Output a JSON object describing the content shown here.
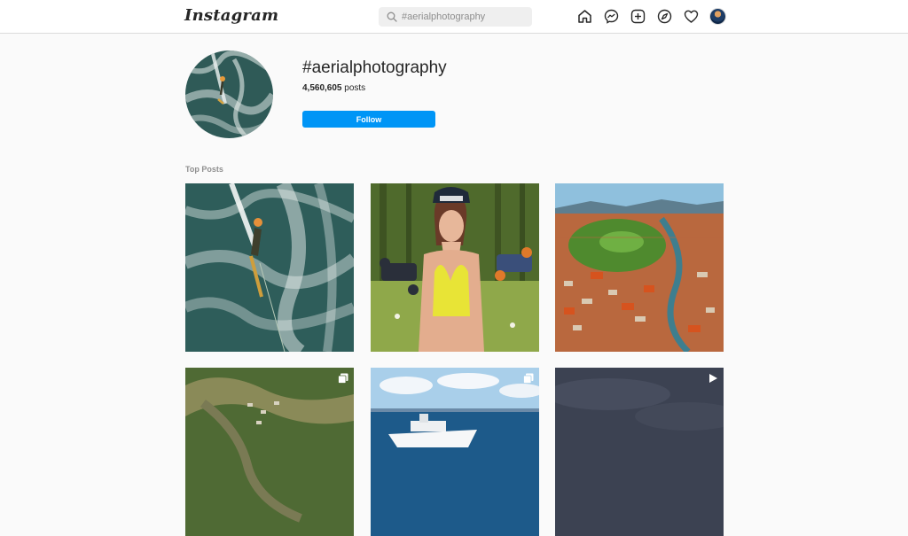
{
  "header": {
    "logo_text": "Instagram",
    "search": {
      "value": "",
      "placeholder": "#aerialphotography"
    },
    "icons": [
      "home-icon",
      "messenger-icon",
      "new-post-icon",
      "explore-icon",
      "activity-heart-icon",
      "profile-avatar"
    ]
  },
  "hashtag": {
    "title": "#aerialphotography",
    "post_count": "4,560,605",
    "post_suffix": " posts",
    "follow_label": "Follow"
  },
  "section": {
    "label": "Top Posts"
  },
  "colors": {
    "accent": "#0095f6",
    "text": "#262626",
    "muted": "#8e8e8e",
    "background": "#fafafa"
  },
  "posts": [
    {
      "name": "wakeboarder-on-water",
      "badge": ""
    },
    {
      "name": "woman-holding-drones",
      "badge": ""
    },
    {
      "name": "aerial-city-view",
      "badge": ""
    },
    {
      "name": "aerial-river-landscape",
      "badge": "carousel-icon"
    },
    {
      "name": "yacht-on-sea",
      "badge": "carousel-icon"
    },
    {
      "name": "dark-sky",
      "badge": "video-icon"
    }
  ]
}
